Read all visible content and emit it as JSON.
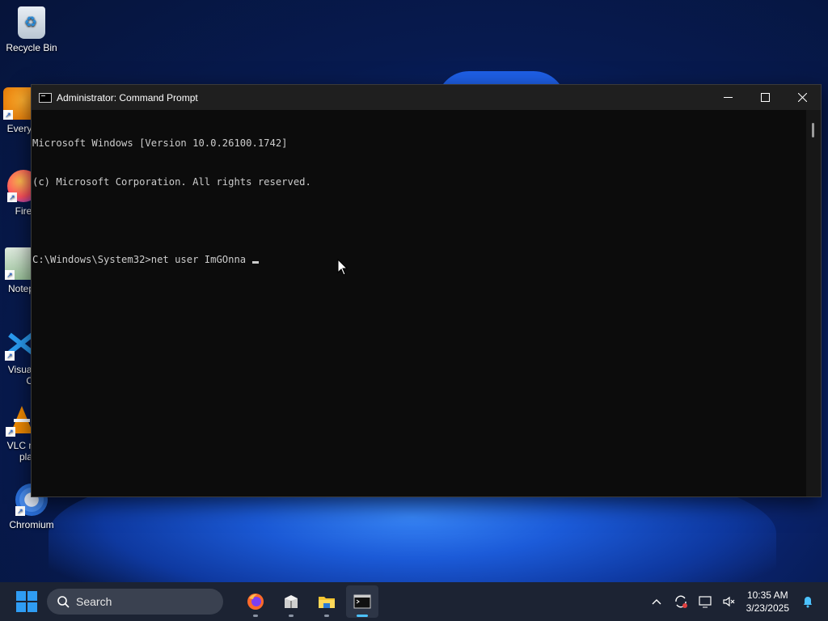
{
  "desktop": {
    "icons": [
      {
        "label": "Recycle Bin"
      },
      {
        "label": "Every"
      },
      {
        "label": "Fire"
      },
      {
        "label": "Notep"
      },
      {
        "label": "Visual"
      },
      {
        "label": "Co"
      },
      {
        "label": "VLC m"
      },
      {
        "label": "pla"
      },
      {
        "label": "Chromium"
      }
    ]
  },
  "window": {
    "title": "Administrator: Command Prompt",
    "minimize": "—",
    "maximize": "☐",
    "close": "✕"
  },
  "console": {
    "lines": [
      "Microsoft Windows [Version 10.0.26100.1742]",
      "(c) Microsoft Corporation. All rights reserved.",
      "",
      "C:\\Windows\\System32>net user ImGOnna "
    ]
  },
  "taskbar": {
    "search_placeholder": "Search",
    "apps": [
      "firefox-icon",
      "package-icon",
      "file-explorer-icon",
      "terminal-icon"
    ],
    "clock_time": "10:35 AM",
    "clock_date": "3/23/2025"
  },
  "colors": {
    "console_bg": "#0c0c0c",
    "console_text": "#cccccc",
    "titlebar": "#1f1f1f",
    "taskbar": "#1c2333",
    "accent": "#4cc2ff"
  }
}
